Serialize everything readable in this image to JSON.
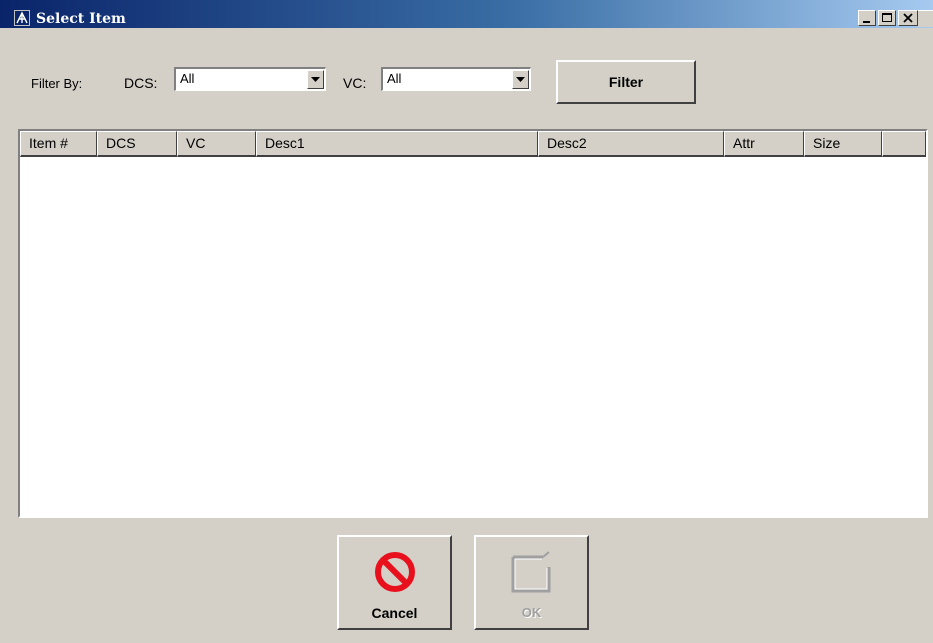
{
  "window": {
    "title": "Select Item",
    "colors": {
      "face": "#d4d0c8",
      "title_start": "#0a246a",
      "title_end": "#a6caf0",
      "cancel_red": "#e8101c"
    }
  },
  "title_buttons": {
    "minimize_icon": "minimize-icon",
    "maximize_icon": "maximize-icon",
    "close_icon": "close-icon"
  },
  "filter": {
    "filter_by_label": "Filter By:",
    "dcs_label": "DCS:",
    "dcs_value": "All",
    "vc_label": "VC:",
    "vc_value": "All",
    "filter_button": "Filter"
  },
  "table": {
    "columns": [
      "Item #",
      "DCS",
      "VC",
      "Desc1",
      "Desc2",
      "Attr",
      "Size"
    ],
    "rows": []
  },
  "buttons": {
    "cancel_label": "Cancel",
    "cancel_icon": "no-entry-icon",
    "ok_label": "OK",
    "ok_icon": "checkbox-icon",
    "ok_enabled": false
  }
}
